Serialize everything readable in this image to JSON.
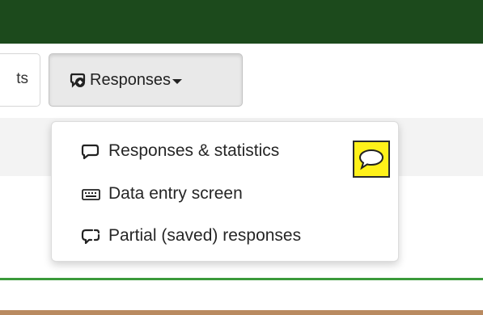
{
  "toolbar": {
    "prev_button_label": "ts",
    "responses_button_label": "Responses",
    "responses_icon": "responses-icon",
    "caret_icon": "caret-down-icon"
  },
  "responses_menu": {
    "items": [
      {
        "label": "Responses & statistics",
        "icon": "speech-bubble-icon"
      },
      {
        "label": "Data entry screen",
        "icon": "keyboard-icon"
      },
      {
        "label": "Partial (saved) responses",
        "icon": "partial-bubble-icon"
      }
    ]
  },
  "overlay": {
    "icon": "speech-bubble-icon",
    "highlight_color": "#fff11a"
  },
  "colors": {
    "topbar": "#1c4a1c",
    "accent_line": "#3a9a3a",
    "bottom_line": "#b98a60"
  }
}
